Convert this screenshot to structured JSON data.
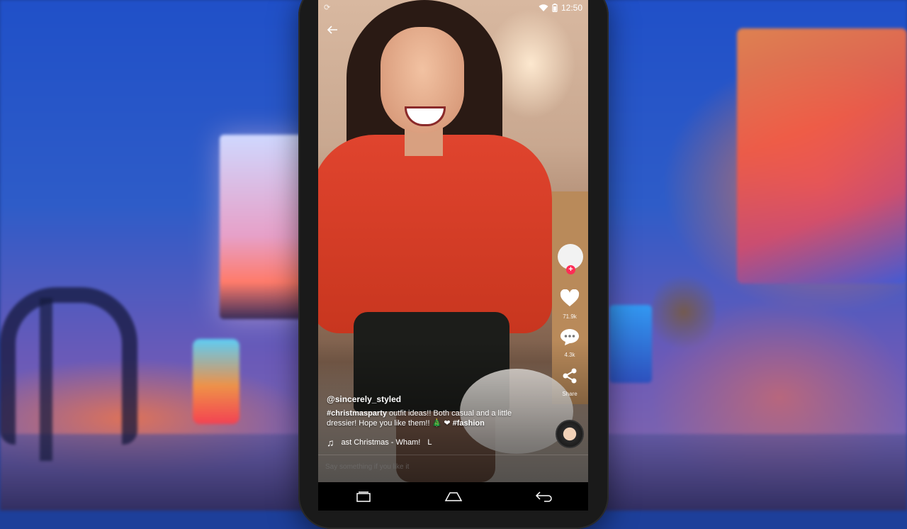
{
  "status": {
    "time": "12:50"
  },
  "video": {
    "username": "@sincerely_styled",
    "description_tag1": "#christmasparty",
    "description_text": " outfit ideas!! Both casual and a little dressier! Hope you like them!! ",
    "emoji": "🎄 ❤",
    "description_tag2": " #fashion",
    "music": "ast Christmas - Wham!",
    "music_extra": "L"
  },
  "actions": {
    "likes": "71.9k",
    "comments": "4.3k",
    "share_label": "Share"
  },
  "comment": {
    "placeholder": "Say something if you like it"
  },
  "colors": {
    "accent": "#fe2c55",
    "navbar": "#000000"
  },
  "icons": {
    "back": "back-arrow-icon",
    "like": "heart-icon",
    "comment": "comment-icon",
    "share": "share-icon",
    "music": "music-note-icon",
    "nav_recent": "recent-apps-icon",
    "nav_home": "home-icon",
    "nav_back": "back-icon"
  }
}
